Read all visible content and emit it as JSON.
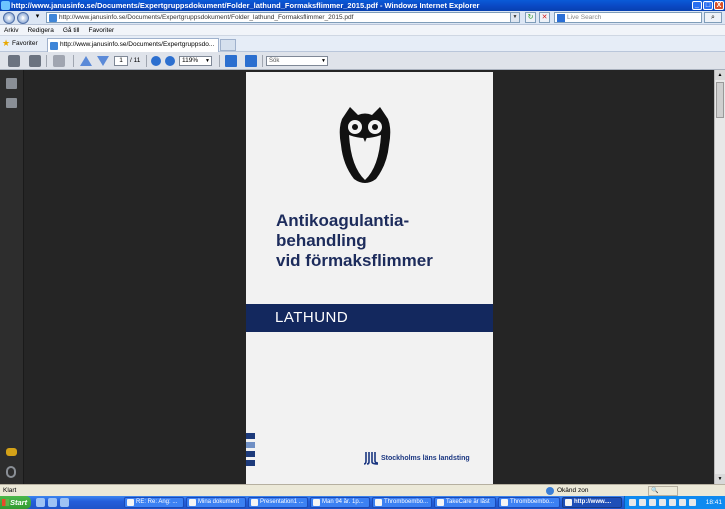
{
  "window": {
    "title": "http://www.janusinfo.se/Documents/Expertgruppsdokument/Folder_lathund_Formaksflimmer_2015.pdf - Windows Internet Explorer",
    "minimize": "_",
    "maximize": "□",
    "close": "X"
  },
  "address": {
    "url": "http://www.janusinfo.se/Documents/Expertgruppsdokument/Folder_lathund_Formaksflimmer_2015.pdf",
    "search_placeholder": "Live Search"
  },
  "menu": [
    "Arkiv",
    "Redigera",
    "Gå till",
    "Favoriter"
  ],
  "favorites": {
    "label": "Favoriter",
    "tab_title": "http://www.janusinfo.se/Documents/Expertgruppsdo..."
  },
  "pdf_toolbar": {
    "page_current": "1",
    "page_total": "/ 11",
    "zoom": "119%",
    "search_placeholder": "Sök"
  },
  "document": {
    "title_lines": [
      "Antikoagulantia-",
      "behandling",
      "vid förmaksflimmer"
    ],
    "band_text": "LATHUND",
    "logo_text": "Stockholms läns landsting"
  },
  "status": {
    "left": "Klart",
    "zone": "Okänd zon",
    "zoom": "🔍"
  },
  "taskbar": {
    "start": "Start",
    "items": [
      "RE: Re: Ang: ...",
      "Mina dokument",
      "Presentation1 ...",
      "Man 94 år. 1p...",
      "Thromboembo...",
      "TakeCare är låst",
      "Thromboembo...",
      "http://www...."
    ],
    "clock": "18:41"
  },
  "colors": {
    "title_navy": "#1d2c5c",
    "band_navy": "#13285e",
    "doc_background": "#252525"
  }
}
